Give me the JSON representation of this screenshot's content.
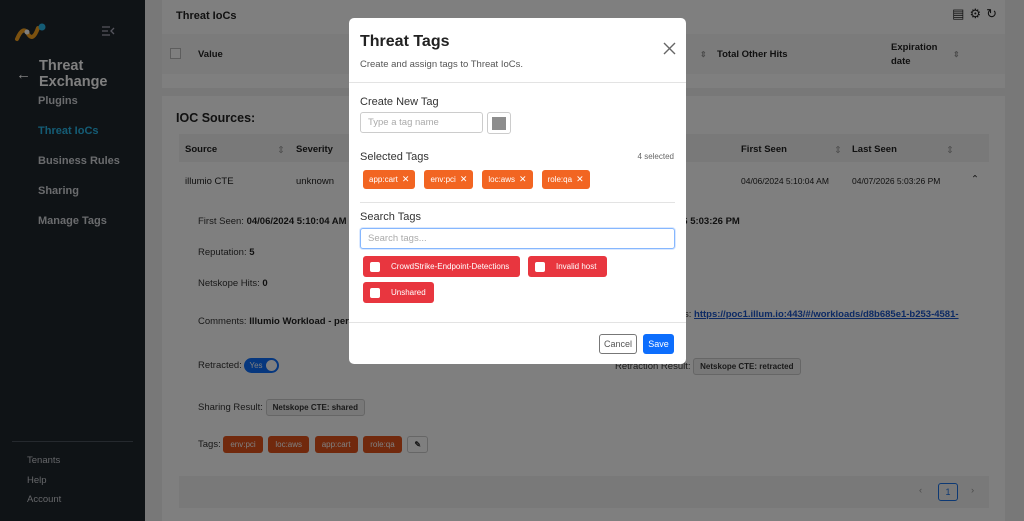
{
  "sidebar": {
    "back_label": "Threat Exchange",
    "items": [
      {
        "label": "Plugins"
      },
      {
        "label": "Threat IoCs"
      },
      {
        "label": "Business Rules"
      },
      {
        "label": "Sharing"
      },
      {
        "label": "Manage Tags"
      }
    ],
    "bottom": [
      "Tenants",
      "Help",
      "Account"
    ],
    "active_color": "#28b8ea"
  },
  "threat_iocs": {
    "title": "Threat IoCs",
    "columns": [
      "Value",
      "Total Other Hits",
      "Expiration",
      "date"
    ]
  },
  "ioc_sources": {
    "title": "IOC Sources:",
    "columns": [
      "Source",
      "Severity",
      "First Seen",
      "Last Seen"
    ],
    "row": {
      "source": "illumio CTE",
      "severity": "unknown",
      "first_seen": "04/06/2024 5:10:04 AM",
      "last_seen": "04/07/2026 5:03:26 PM"
    },
    "detail": {
      "first_seen_label": "First Seen:",
      "first_seen_value": "04/06/2024 5:10:04 AM",
      "last_seen_partial": "26 5:03:26 PM",
      "reputation_label": "Reputation:",
      "reputation_value": "5",
      "hits_label": "Netskope Hits:",
      "hits_value": "0",
      "comments_label": "Comments:",
      "comments_value": "Illumio Workload - per",
      "url_label_partial": "s:",
      "url_value": "https://poc1.illum.io:443/#/workloads/d8b685e1-b253-4581-",
      "retracted_label": "Retracted:",
      "retracted_value": "Yes",
      "retraction_label": "Retraction Result:",
      "retraction_value": "Netskope CTE: retracted",
      "sharing_label": "Sharing Result:",
      "sharing_value": "Netskope CTE: shared",
      "tags_label": "Tags:",
      "tags": [
        "env:pci",
        "loc:aws",
        "app:cart",
        "role:qa"
      ]
    },
    "pager": {
      "prev": "‹",
      "page": "1",
      "next": "›"
    }
  },
  "modal": {
    "title": "Threat Tags",
    "subtitle": "Create and assign tags to Threat IoCs.",
    "create_label": "Create New Tag",
    "create_placeholder": "Type a tag name",
    "swatch_color": "#8d8d8d",
    "selected_label": "Selected Tags",
    "selected_count": "4 selected",
    "selected_tags": [
      {
        "label": "app:cart",
        "remove": "✕"
      },
      {
        "label": "env:pci",
        "remove": "✕"
      },
      {
        "label": "loc:aws",
        "remove": "✕"
      },
      {
        "label": "role:qa",
        "remove": "✕"
      }
    ],
    "search_label": "Search Tags",
    "search_placeholder": "Search tags...",
    "options": [
      {
        "label": "CrowdStrike-Endpoint-Detections"
      },
      {
        "label": "Invalid host"
      },
      {
        "label": "Unshared"
      }
    ],
    "cancel_label": "Cancel",
    "save_label": "Save"
  },
  "colors": {
    "sidebar_bg": "#1f262d",
    "tag_orange": "#f26522",
    "option_red": "#e8363f",
    "primary": "#0d6efd"
  }
}
